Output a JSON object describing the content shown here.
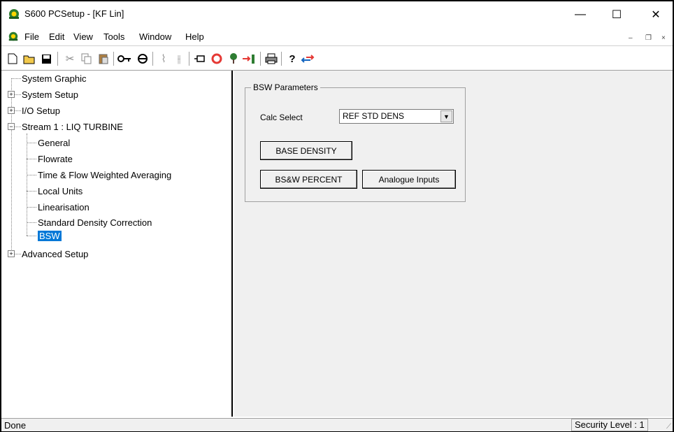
{
  "window": {
    "title": "S600 PCSetup  - [KF Lin]",
    "minimize": "—",
    "maximize": "☐",
    "close": "✕"
  },
  "menu": {
    "items": [
      "File",
      "Edit",
      "View",
      "Tools",
      "Window",
      "Help"
    ],
    "mdi_minimize": "–",
    "mdi_restore": "❐",
    "mdi_close": "×"
  },
  "toolbar": {
    "icons": [
      "new-icon",
      "open-icon",
      "save-icon",
      "cut-icon",
      "copy-icon",
      "paste-icon",
      "key-icon",
      "connect-icon",
      "wizard-icon",
      "tune-icon",
      "tag-icon",
      "stop-icon",
      "tree-icon",
      "transfer-icon",
      "print-icon",
      "help-icon",
      "arrows-icon"
    ]
  },
  "tree": {
    "items": [
      "System Graphic",
      "System Setup",
      "I/O Setup",
      "Stream 1 : LIQ TURBINE",
      "General",
      "Flowrate",
      "Time & Flow Weighted Averaging",
      "Local Units",
      "Linearisation",
      "Standard Density Correction",
      "BSW",
      "Advanced Setup"
    ]
  },
  "panel": {
    "group_title": "BSW Parameters",
    "calc_select_label": "Calc Select",
    "calc_select_value": "REF STD DENS",
    "base_density_button": "BASE DENSITY",
    "bsw_percent_button": "BS&W PERCENT",
    "analogue_inputs_button": "Analogue Inputs"
  },
  "status": {
    "left": "Done",
    "right": "Security Level : 1"
  },
  "colors": {
    "selection": "#0078d7",
    "panel_bg": "#f0f0f0"
  }
}
